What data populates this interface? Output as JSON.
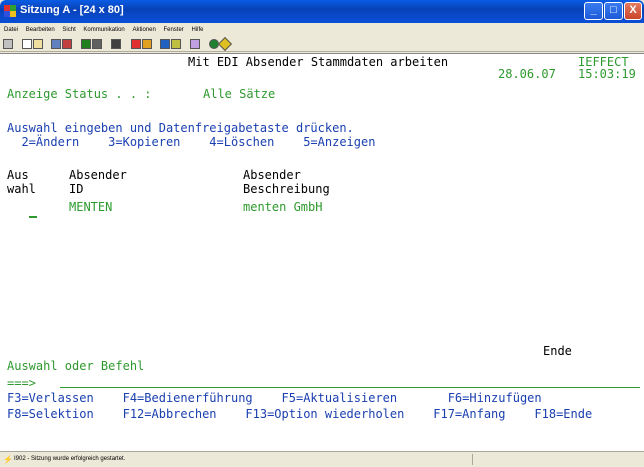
{
  "window": {
    "title": "Sitzung A - [24 x 80]",
    "min_label": "_",
    "max_label": "□",
    "close_label": "X"
  },
  "menu": [
    "Datei",
    "Bearbeiten",
    "Sicht",
    "Kommunikation",
    "Aktionen",
    "Fenster",
    "Hilfe"
  ],
  "toolbar_icons": [
    "print-icon",
    "copy-icon",
    "paste-icon",
    "send-icon",
    "receive-icon",
    "display-icon",
    "macro-icon",
    "macro-play-icon",
    "record-icon",
    "transfer-icon",
    "transfer-back-icon",
    "clipboard-icon",
    "globe-icon",
    "edit-icon"
  ],
  "screen": {
    "title": "Mit EDI Absender Stammdaten arbeiten",
    "system": "IEFFECT",
    "date": "28.06.07",
    "time": "15:03:19",
    "status_label": "Anzeige Status . . :",
    "status_value": "Alle Sätze",
    "instruction": "Auswahl eingeben und Datenfreigabetaste drücken.",
    "options": "  2=Ändern    3=Kopieren    4=Löschen    5=Anzeigen",
    "col_aus": "Aus",
    "col_wahl": "wahl",
    "col_absender1": "Absender",
    "col_id": "ID",
    "col_absender2": "Absender",
    "col_beschreibung": "Beschreibung",
    "rows": [
      {
        "id": "MENTEN",
        "description": "menten GmbH"
      }
    ],
    "end_marker": "Ende",
    "command_label": "Auswahl oder Befehl",
    "prompt": "===>",
    "fkeys_line1": "F3=Verlassen    F4=Bedienerführung    F5=Aktualisieren       F6=Hinzufügen",
    "fkeys_line2": "F8=Selektion    F12=Abbrechen    F13=Option wiederholen    F17=Anfang    F18=Ende"
  },
  "statusbar": {
    "message": "I902 - Sitzung wurde erfolgreich gestartet."
  },
  "colors": {
    "terminal_green": "#2e9a2e",
    "title_bar": "#0842b8"
  }
}
